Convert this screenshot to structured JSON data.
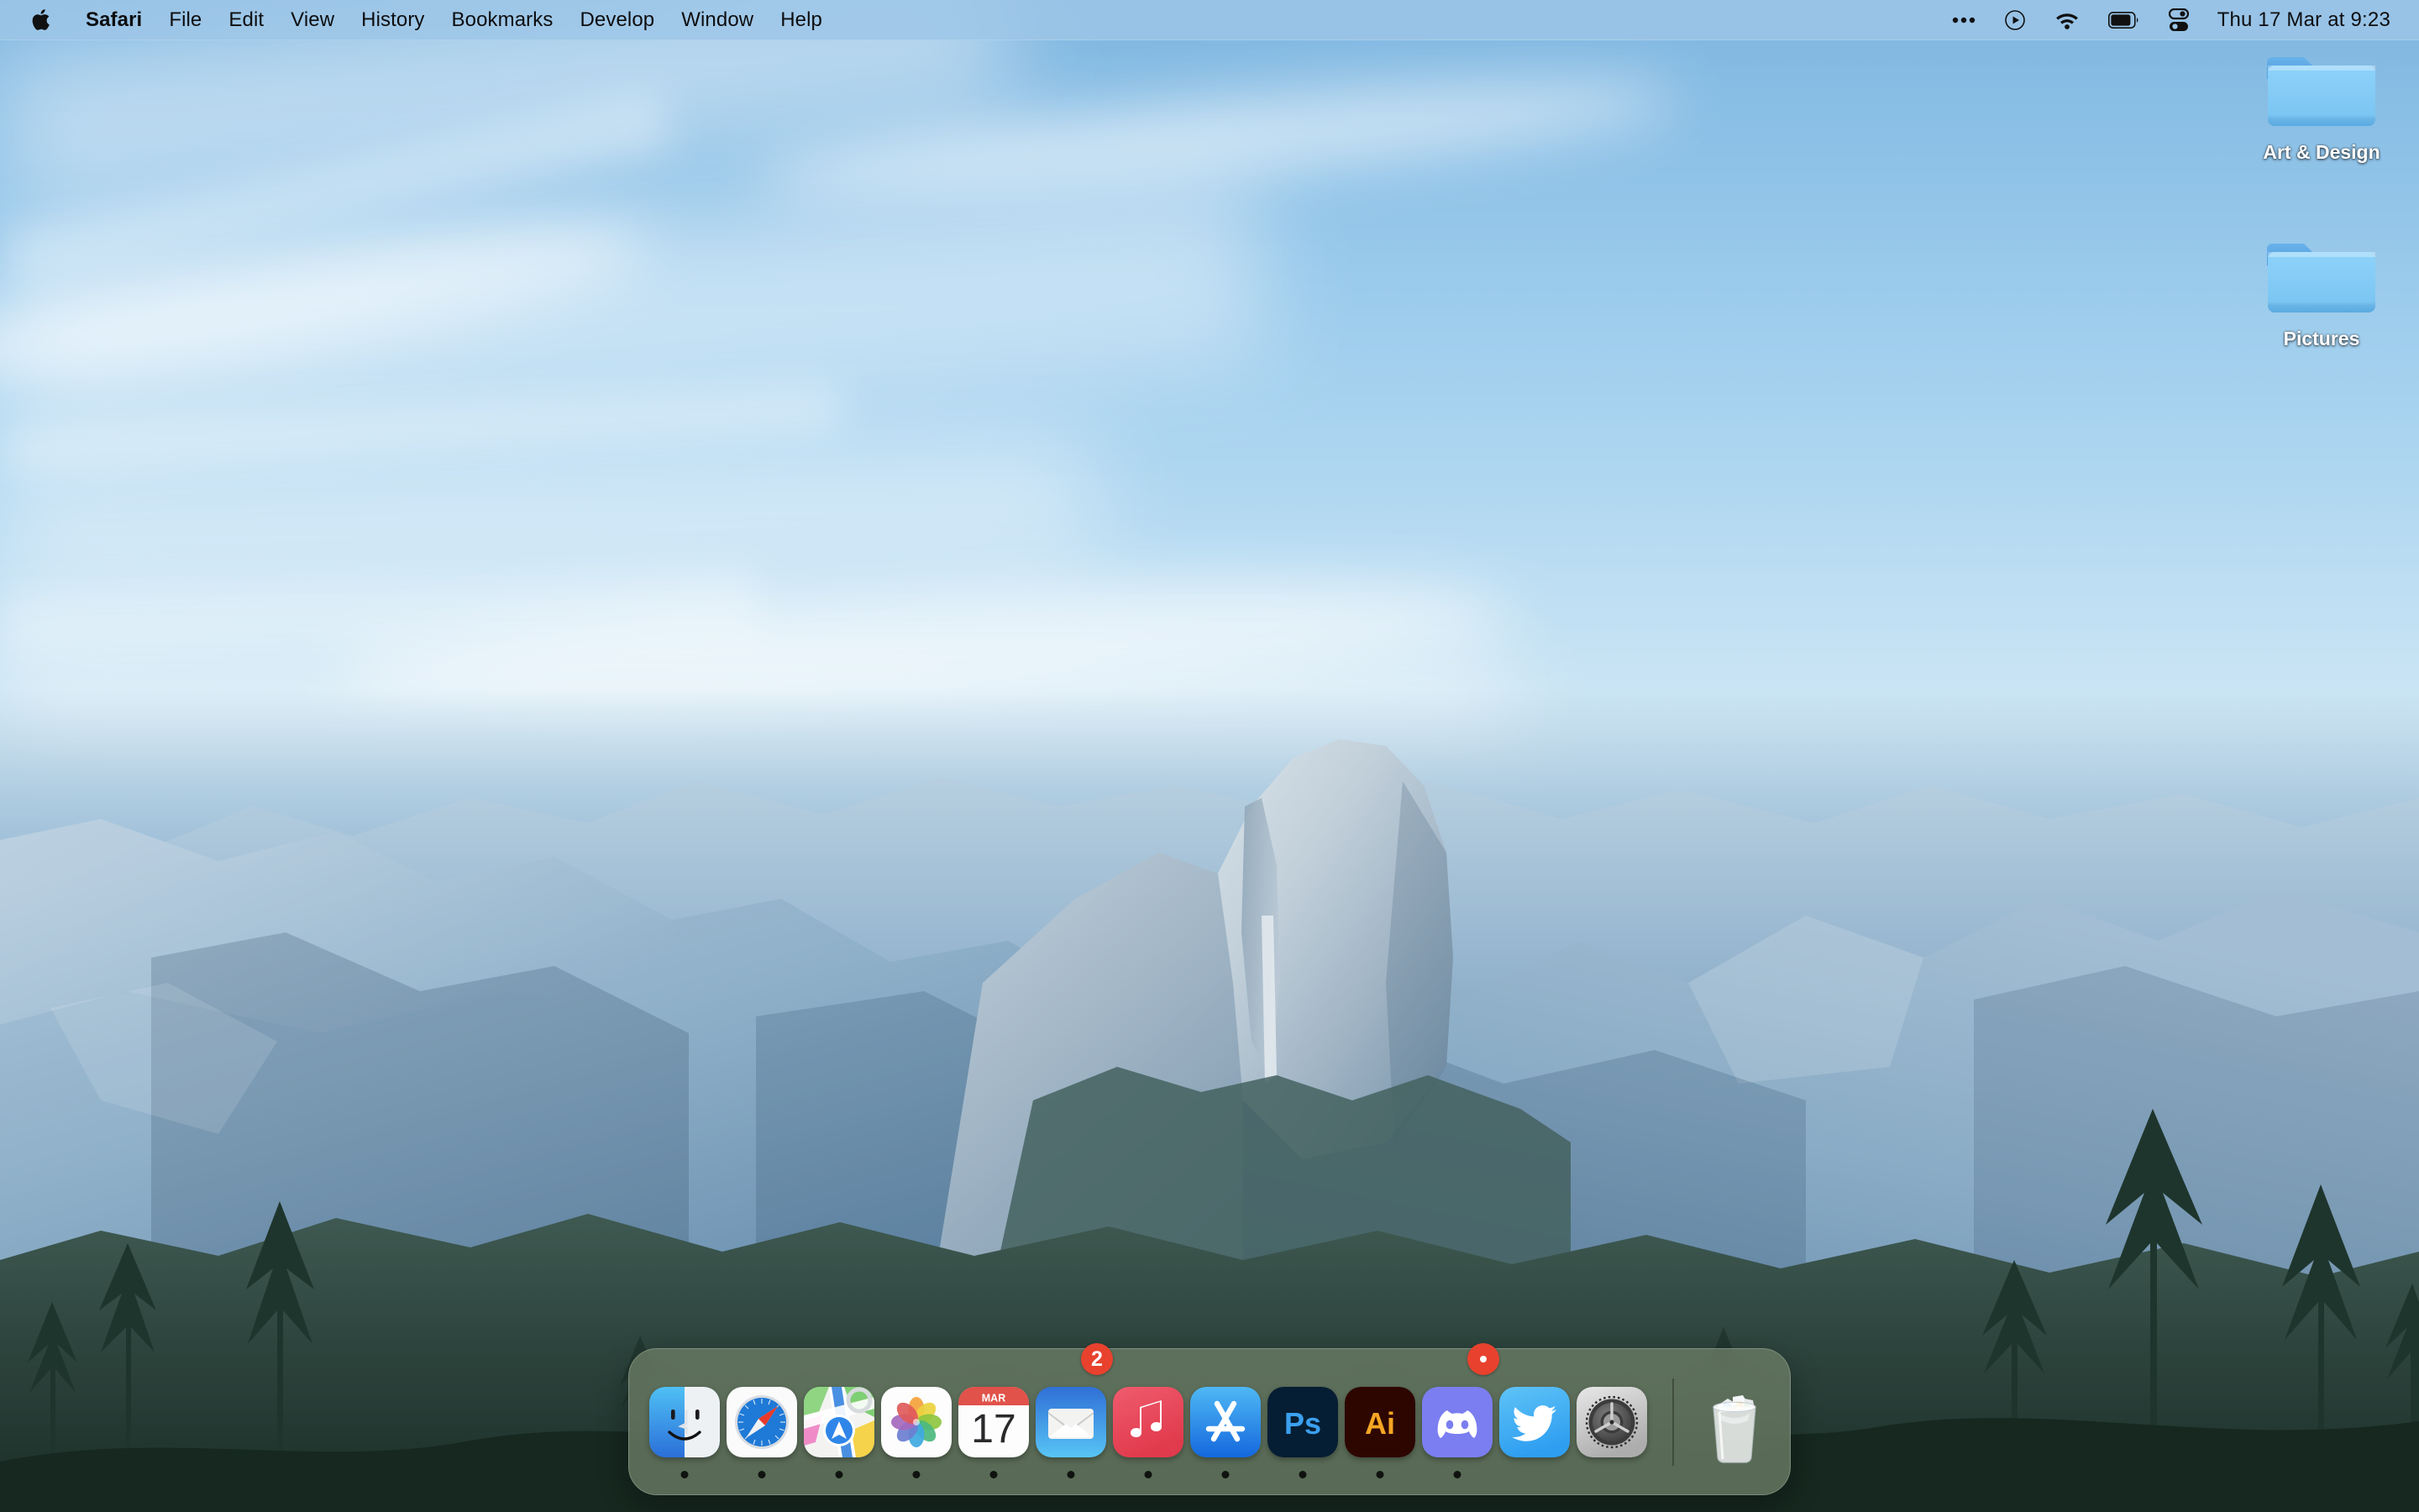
{
  "menubar": {
    "apple_icon": "apple-logo-icon",
    "items": [
      {
        "label": "Safari",
        "active": true
      },
      {
        "label": "File",
        "active": false
      },
      {
        "label": "Edit",
        "active": false
      },
      {
        "label": "View",
        "active": false
      },
      {
        "label": "History",
        "active": false
      },
      {
        "label": "Bookmarks",
        "active": false
      },
      {
        "label": "Develop",
        "active": false
      },
      {
        "label": "Window",
        "active": false
      },
      {
        "label": "Help",
        "active": false
      }
    ],
    "status_icons": [
      {
        "name": "more-ellipsis-icon"
      },
      {
        "name": "now-playing-icon"
      },
      {
        "name": "wifi-icon"
      },
      {
        "name": "battery-icon"
      },
      {
        "name": "control-center-icon"
      }
    ],
    "clock": "Thu 17 Mar at  9:23",
    "background_color": "#9dc6e6"
  },
  "desktop": {
    "icons": [
      {
        "label": "Art & Design",
        "icon": "folder-icon",
        "color": "#7ec8f5"
      },
      {
        "label": "Pictures",
        "icon": "folder-icon",
        "color": "#7ec8f5"
      }
    ],
    "wallpaper_name": "yosemite-half-dome"
  },
  "dock": {
    "background_color": "#6a7c64",
    "items": [
      {
        "label": "Finder",
        "icon": "finder-icon",
        "running": true,
        "badge": null
      },
      {
        "label": "Safari",
        "icon": "safari-compass-icon",
        "running": true,
        "badge": null
      },
      {
        "label": "Maps",
        "icon": "maps-icon",
        "running": true,
        "badge": null
      },
      {
        "label": "Photos",
        "icon": "photos-pinwheel-icon",
        "running": true,
        "badge": null
      },
      {
        "label": "Calendar",
        "icon": "calendar-icon",
        "running": true,
        "badge": null,
        "month": "MAR",
        "day": "17"
      },
      {
        "label": "Mail",
        "icon": "mail-envelope-icon",
        "running": true,
        "badge": "2"
      },
      {
        "label": "Music",
        "icon": "music-note-icon",
        "running": true,
        "badge": null
      },
      {
        "label": "App Store",
        "icon": "app-store-icon",
        "running": true,
        "badge": null
      },
      {
        "label": "Photoshop",
        "icon": "photoshop-icon",
        "running": true,
        "badge": null,
        "glyph": "Ps"
      },
      {
        "label": "Illustrator",
        "icon": "illustrator-icon",
        "running": true,
        "badge": null,
        "glyph": "Ai"
      },
      {
        "label": "Discord",
        "icon": "discord-icon",
        "running": true,
        "badge": "dot"
      },
      {
        "label": "Twitter",
        "icon": "twitter-bird-icon",
        "running": false,
        "badge": null
      },
      {
        "label": "System Settings",
        "icon": "gear-settings-icon",
        "running": false,
        "badge": null
      }
    ],
    "separator": true,
    "trash": {
      "label": "Trash",
      "icon": "trash-full-icon",
      "full": true
    }
  }
}
